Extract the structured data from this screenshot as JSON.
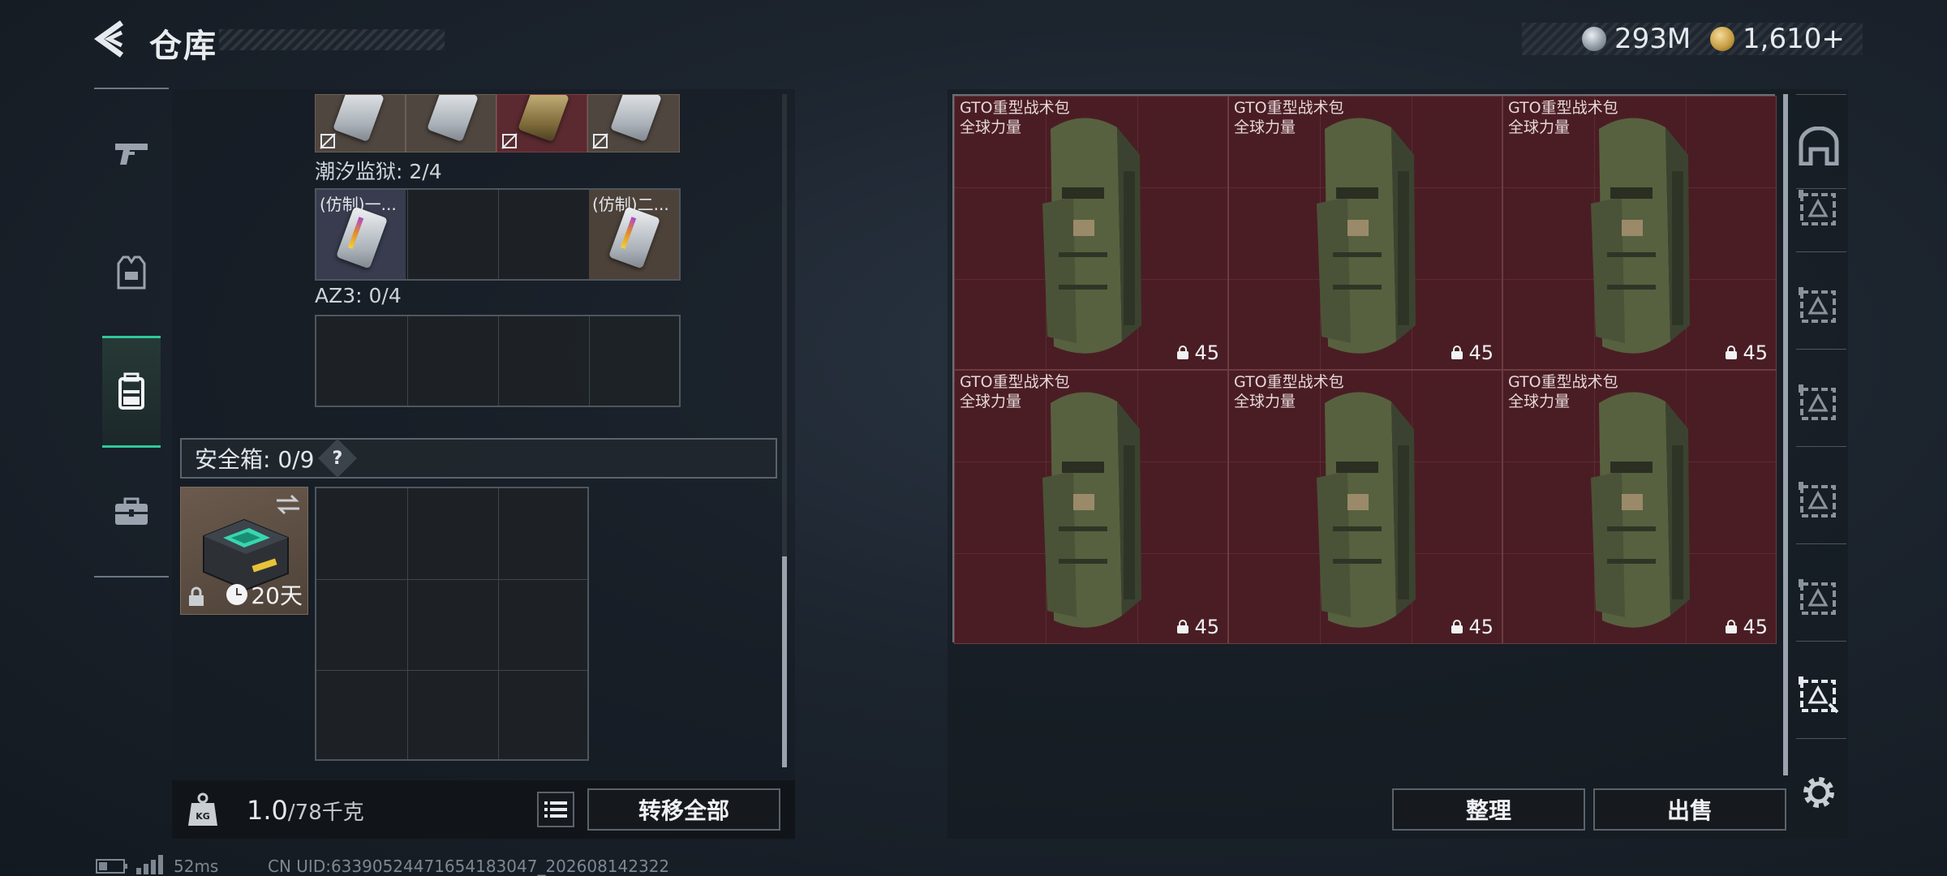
{
  "header": {
    "title": "仓库"
  },
  "currency": {
    "silver": "293M",
    "gold": "1,610+"
  },
  "left_nav": {
    "items": [
      {
        "name": "weapons",
        "icon": "pistol-icon"
      },
      {
        "name": "armor",
        "icon": "vest-icon"
      },
      {
        "name": "backpack",
        "icon": "backpack-icon",
        "active": true
      },
      {
        "name": "equipment",
        "icon": "toolbox-icon"
      }
    ]
  },
  "keycards": {
    "tide_prison": {
      "label": "潮汐监狱: 2/4",
      "items": [
        "(仿制)一...",
        "(仿制)二..."
      ]
    },
    "az3": {
      "label": "AZ3: 0/4"
    }
  },
  "safe_box": {
    "header": "安全箱:  0/9",
    "help": "?",
    "timer": "20天"
  },
  "weight": {
    "current": "1.0",
    "max": "/78千克"
  },
  "buttons": {
    "transfer_all": "转移全部",
    "organize": "整理",
    "sell": "出售"
  },
  "stash": {
    "items": [
      {
        "name_line1": "GTO重型战术包",
        "name_line2": "全球力量",
        "qty": "45"
      },
      {
        "name_line1": "GTO重型战术包",
        "name_line2": "全球力量",
        "qty": "45"
      },
      {
        "name_line1": "GTO重型战术包",
        "name_line2": "全球力量",
        "qty": "45"
      },
      {
        "name_line1": "GTO重型战术包",
        "name_line2": "全球力量",
        "qty": "45"
      },
      {
        "name_line1": "GTO重型战术包",
        "name_line2": "全球力量",
        "qty": "45"
      },
      {
        "name_line1": "GTO重型战术包",
        "name_line2": "全球力量",
        "qty": "45"
      }
    ]
  },
  "status": {
    "ping": "52ms",
    "uid": "CN UID:6339052447165418304​7_202608142322"
  }
}
